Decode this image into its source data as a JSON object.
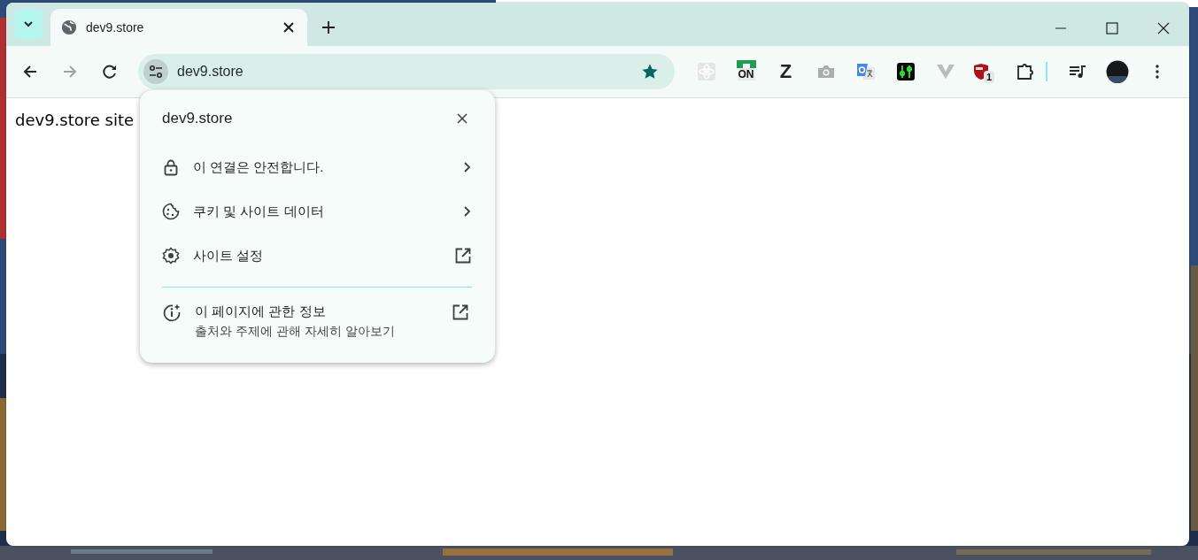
{
  "tab": {
    "title": "dev9.store",
    "selected": true
  },
  "address": {
    "url": "dev9.store",
    "bookmarked": true
  },
  "extensions": [
    {
      "kind": "atom"
    },
    {
      "kind": "on",
      "label": "ON"
    },
    {
      "kind": "letter",
      "label": "Z"
    },
    {
      "kind": "camera"
    },
    {
      "kind": "translate"
    },
    {
      "kind": "sliders"
    },
    {
      "kind": "v"
    },
    {
      "kind": "shield",
      "badge": "1"
    },
    {
      "kind": "puzzle"
    }
  ],
  "page": {
    "text": "dev9.store site"
  },
  "popup": {
    "title": "dev9.store",
    "items": [
      {
        "kind": "submenu",
        "label": "이 연결은 안전합니다."
      },
      {
        "kind": "submenu",
        "label": "쿠키 및 사이트 데이터"
      },
      {
        "kind": "link",
        "label": "사이트 설정"
      }
    ],
    "about": {
      "kind": "link",
      "label": "이 페이지에 관한 정보",
      "sub": "출처와 주제에 관해 자세히 알아보기"
    }
  }
}
